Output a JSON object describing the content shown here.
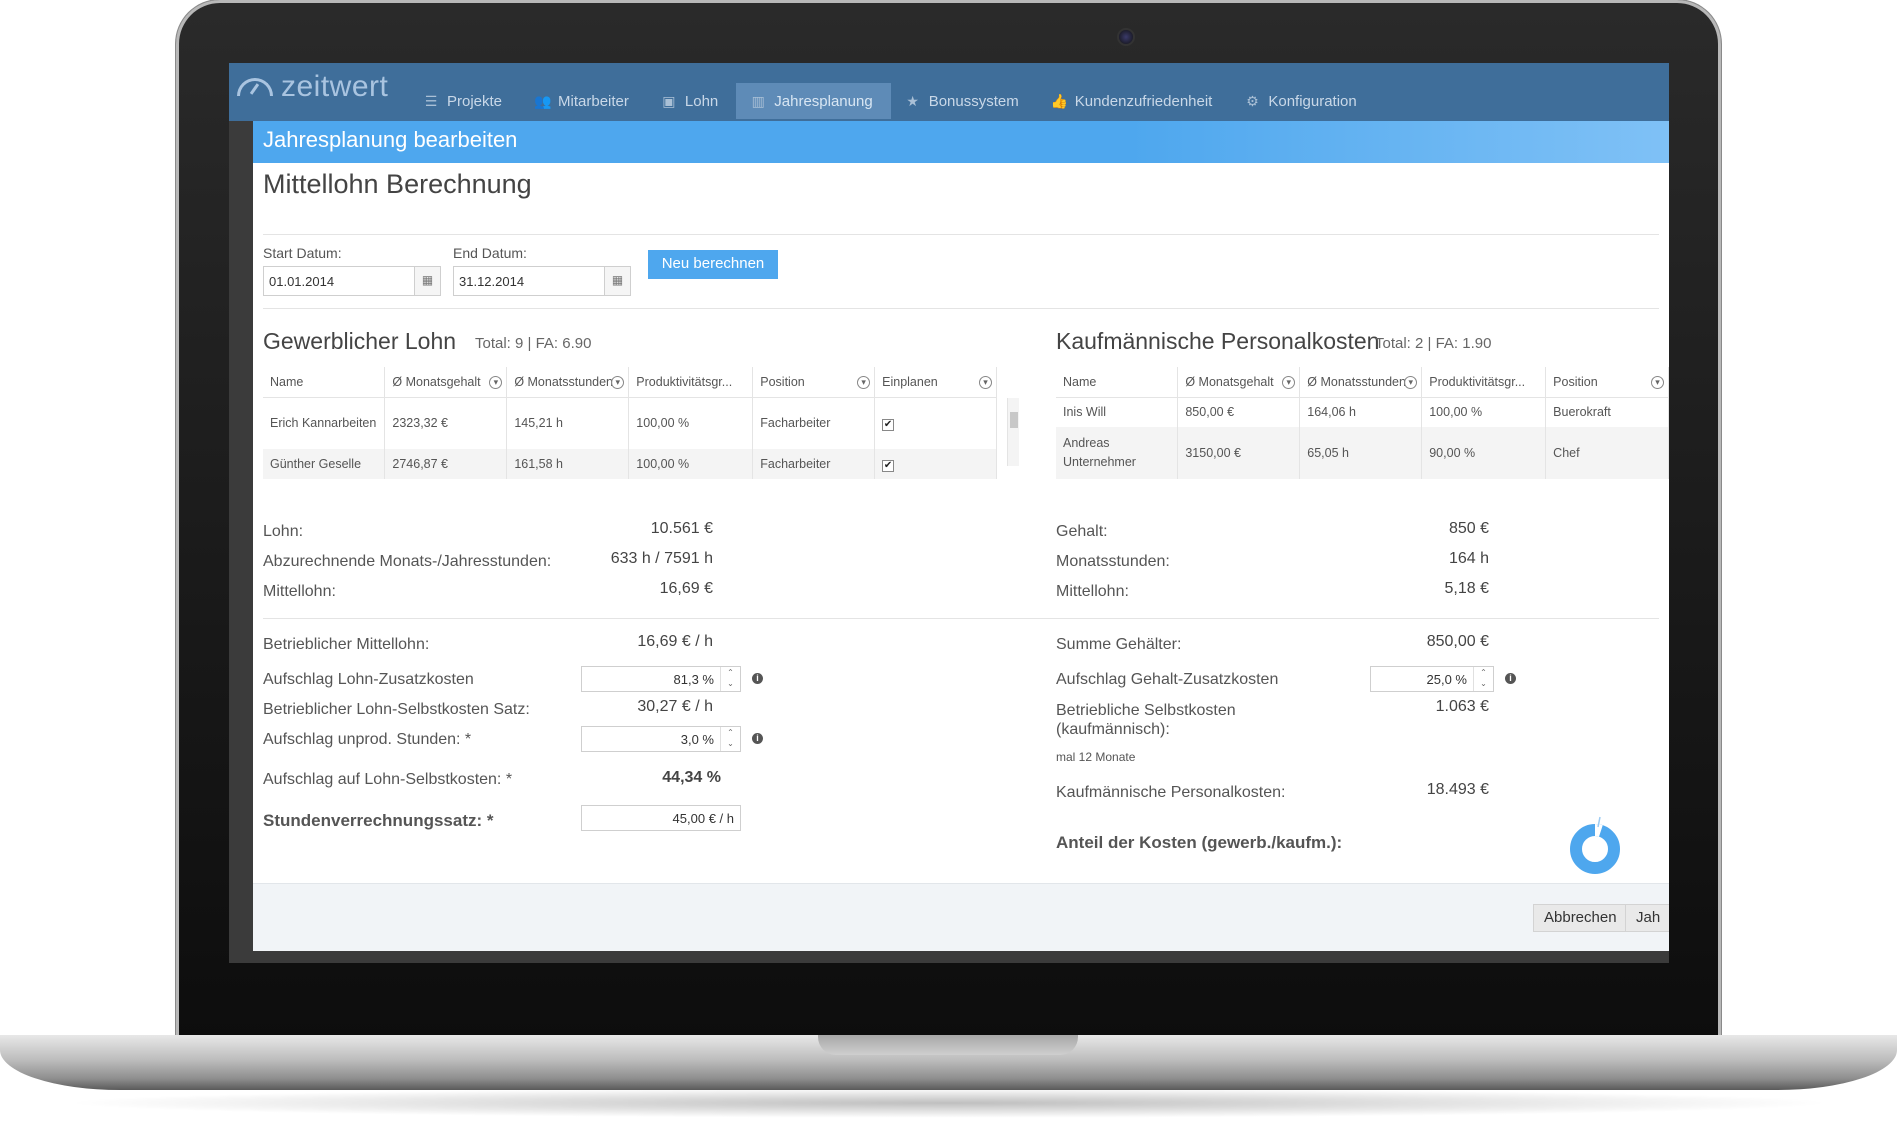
{
  "app": {
    "logo": "zeitwert",
    "nav": [
      {
        "label": "Projekte",
        "icon": "list-icon"
      },
      {
        "label": "Mitarbeiter",
        "icon": "users-icon"
      },
      {
        "label": "Lohn",
        "icon": "money-icon"
      },
      {
        "label": "Jahresplanung",
        "icon": "bar-chart-icon"
      },
      {
        "label": "Bonussystem",
        "icon": "star-icon"
      },
      {
        "label": "Kundenzufriedenheit",
        "icon": "thumbs-up-icon"
      },
      {
        "label": "Konfiguration",
        "icon": "gear-icon"
      }
    ],
    "active_nav": "Jahresplanung"
  },
  "modal": {
    "title": "Jahresplanung bearbeiten",
    "heading": "Mittellohn Berechnung",
    "start_label": "Start Datum:",
    "start_value": "01.01.2014",
    "end_label": "End Datum:",
    "end_value": "31.12.2014",
    "recalc_label": "Neu berechnen",
    "cancel_label": "Abbrechen",
    "save_label": "Jah"
  },
  "gewerblich": {
    "title": "Gewerblicher Lohn",
    "summary": "Total: 9 | FA: 6.90",
    "columns": [
      "Name",
      "Ø Monatsgehalt",
      "Ø Monatsstunden",
      "Produktivitätsgr...",
      "Position",
      "Einplanen"
    ],
    "rows": [
      {
        "name": "Erich Kannarbeiten",
        "gehalt": "2323,32 €",
        "stunden": "145,21 h",
        "prod": "100,00 %",
        "position": "Facharbeiter",
        "einplanen": "✔"
      },
      {
        "name": "Günther Geselle",
        "gehalt": "2746,87 €",
        "stunden": "161,58 h",
        "prod": "100,00 %",
        "position": "Facharbeiter",
        "einplanen": "✔"
      }
    ],
    "lohn_label": "Lohn:",
    "lohn_value": "10.561 €",
    "stunden_label": "Abzurechnende Monats-/Jahresstunden:",
    "stunden_value": "633 h / 7591 h",
    "mittellohn_label": "Mittellohn:",
    "mittellohn_value": "16,69 €",
    "betr_mittellohn_label": "Betrieblicher Mittellohn:",
    "betr_mittellohn_value": "16,69 € / h",
    "aufschlag_zusatz_label": "Aufschlag Lohn-Zusatzkosten",
    "aufschlag_zusatz_value": "81,3 %",
    "selbstkosten_satz_label": "Betrieblicher Lohn-Selbstkosten Satz:",
    "selbstkosten_satz_value": "30,27 € / h",
    "unprod_label": "Aufschlag unprod. Stunden: *",
    "unprod_value": "3,0 %",
    "aufschlag_selbst_label": "Aufschlag auf Lohn-Selbstkosten: *",
    "aufschlag_selbst_value": "44,34 %",
    "stundensatz_label": "Stundenverrechnungssatz: *",
    "stundensatz_value": "45,00 € / h"
  },
  "kaufmaennisch": {
    "title": "Kaufmännische Personalkosten",
    "summary": "Total: 2 | FA: 1.90",
    "columns": [
      "Name",
      "Ø Monatsgehalt",
      "Ø Monatsstunden",
      "Produktivitätsgr...",
      "Position"
    ],
    "rows": [
      {
        "name": "Inis Will",
        "gehalt": "850,00 €",
        "stunden": "164,06 h",
        "prod": "100,00 %",
        "position": "Buerokraft"
      },
      {
        "name": "Andreas Unternehmer",
        "gehalt": "3150,00 €",
        "stunden": "65,05 h",
        "prod": "90,00 %",
        "position": "Chef"
      }
    ],
    "gehalt_label": "Gehalt:",
    "gehalt_value": "850 €",
    "monatsstunden_label": "Monatsstunden:",
    "monatsstunden_value": "164 h",
    "mittellohn_label": "Mittellohn:",
    "mittellohn_value": "5,18 €",
    "summe_label": "Summe Gehälter:",
    "summe_value": "850,00 €",
    "aufschlag_label": "Aufschlag Gehalt-Zusatzkosten",
    "aufschlag_value": "25,0 %",
    "selbstkosten_label": "Betriebliche Selbstkosten (kaufmännisch):",
    "selbstkosten_value": "1.063 €",
    "selbstkosten_note": "mal 12 Monate",
    "personalkosten_label": "Kaufmännische Personalkosten:",
    "personalkosten_value": "18.493 €",
    "anteil_label": "Anteil der Kosten (gewerb./kaufm.):",
    "anteil_kaufm_fraction": 0.05,
    "colors": {
      "accent": "#4ea7ee",
      "remainder": "#ffffff"
    }
  }
}
